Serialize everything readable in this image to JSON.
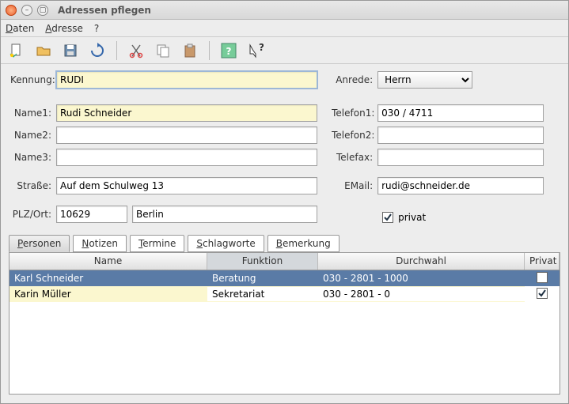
{
  "window": {
    "title": "Adressen pflegen"
  },
  "menu": {
    "daten": "Daten",
    "adresse": "Adresse",
    "help": "?"
  },
  "toolbar_icons": [
    "new",
    "open",
    "save",
    "reload",
    "cut",
    "copy",
    "paste",
    "help",
    "whatsthis"
  ],
  "form": {
    "kennung_label": "Kennung:",
    "kennung": "RUDI",
    "anrede_label": "Anrede:",
    "anrede": "Herrn",
    "name1_label": "Name1:",
    "name1": "Rudi Schneider",
    "name2_label": "Name2:",
    "name2": "",
    "name3_label": "Name3:",
    "name3": "",
    "strasse_label": "Straße:",
    "strasse": "Auf dem Schulweg 13",
    "plzort_label": "PLZ/Ort:",
    "plz": "10629",
    "ort": "Berlin",
    "telefon1_label": "Telefon1:",
    "telefon1": "030 / 4711",
    "telefon2_label": "Telefon2:",
    "telefon2": "",
    "telefax_label": "Telefax:",
    "telefax": "",
    "email_label": "EMail:",
    "email": "rudi@schneider.de",
    "privat_label": "privat",
    "privat_checked": true
  },
  "tabs": {
    "personen": "Personen",
    "notizen": "Notizen",
    "termine": "Termine",
    "schlagworte": "Schlagworte",
    "bemerkung": "Bemerkung",
    "active": "personen"
  },
  "grid": {
    "headers": {
      "name": "Name",
      "funktion": "Funktion",
      "durchwahl": "Durchwahl",
      "privat": "Privat"
    },
    "rows": [
      {
        "name": "Karl Schneider",
        "funktion": "Beratung",
        "durchwahl": "030 - 2801 - 1000",
        "privat": false
      },
      {
        "name": "Karin Müller",
        "funktion": "Sekretariat",
        "durchwahl": "030 - 2801 - 0",
        "privat": true
      }
    ]
  }
}
